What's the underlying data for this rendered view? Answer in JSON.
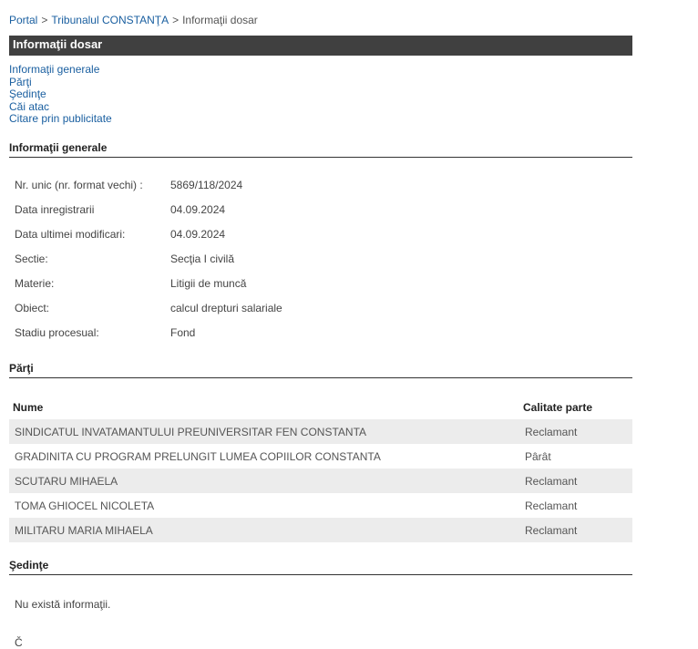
{
  "breadcrumb": {
    "items": [
      "Portal",
      "Tribunalul CONSTANŢA",
      "Informaţii dosar"
    ],
    "separator": ">"
  },
  "banner": {
    "title": "Informaţii dosar"
  },
  "toc": [
    "Informaţii generale",
    "Părţi",
    "Şedinţe",
    "Căi atac",
    "Citare prin publicitate"
  ],
  "info_general": {
    "heading": "Informaţii generale",
    "rows": [
      {
        "label": "Nr. unic (nr. format vechi) :",
        "value": "5869/118/2024"
      },
      {
        "label": "Data inregistrarii",
        "value": "04.09.2024"
      },
      {
        "label": "Data ultimei modificari:",
        "value": "04.09.2024"
      },
      {
        "label": "Sectie:",
        "value": "Secţia I civilă"
      },
      {
        "label": "Materie:",
        "value": "Litigii de muncă"
      },
      {
        "label": "Obiect:",
        "value": "calcul drepturi salariale"
      },
      {
        "label": "Stadiu procesual:",
        "value": "Fond"
      }
    ]
  },
  "parti": {
    "heading": "Părţi",
    "columns": [
      "Nume",
      "Calitate parte"
    ],
    "rows": [
      {
        "nume": "SINDICATUL INVATAMANTULUI PREUNIVERSITAR FEN CONSTANTA",
        "calitate": "Reclamant"
      },
      {
        "nume": "GRADINITA CU PROGRAM PRELUNGIT LUMEA COPIILOR CONSTANTA",
        "calitate": "Pârât"
      },
      {
        "nume": "SCUTARU MIHAELA",
        "calitate": "Reclamant"
      },
      {
        "nume": "TOMA GHIOCEL NICOLETA",
        "calitate": "Reclamant"
      },
      {
        "nume": "MILITARU MARIA MIHAELA",
        "calitate": "Reclamant"
      }
    ]
  },
  "sedinte": {
    "heading": "Şedinţe",
    "empty_text": "Nu există informaţii."
  },
  "next_section_partial": "Č",
  "colors": {
    "link": "#1a5fa0",
    "banner_bg": "#404040",
    "row_alt": "#ececec"
  }
}
